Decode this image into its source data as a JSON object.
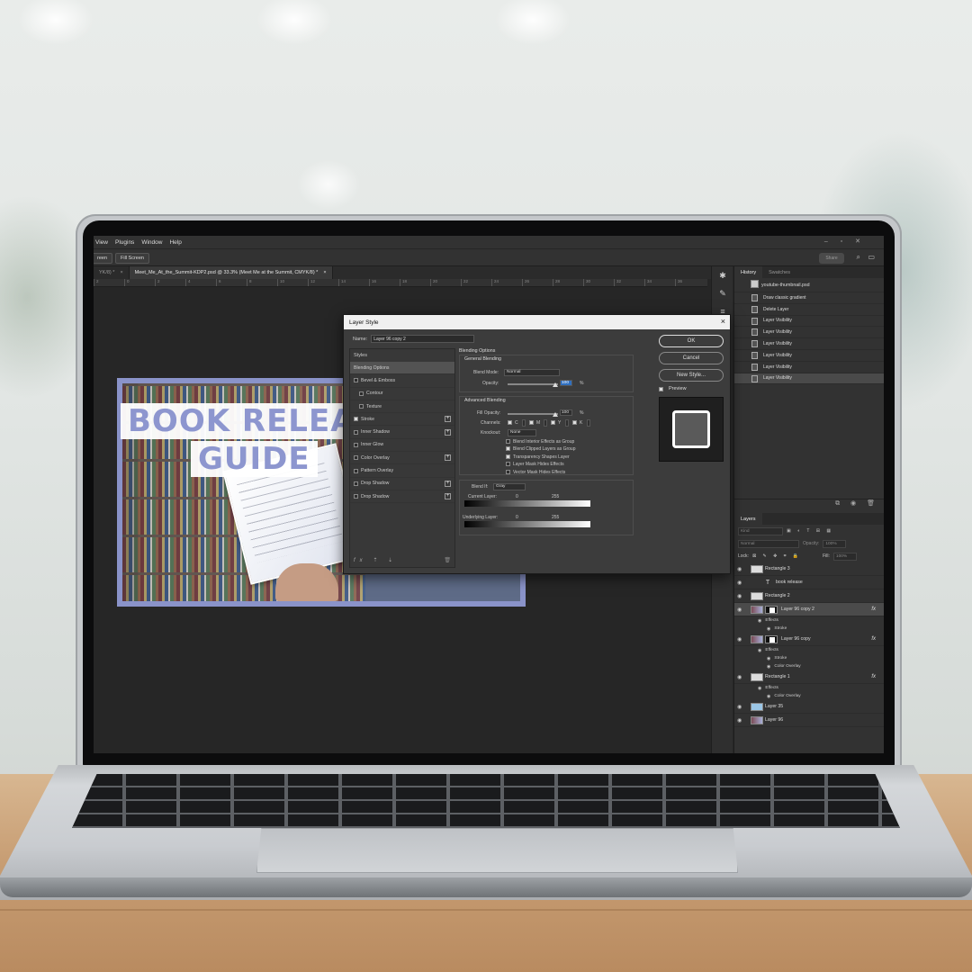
{
  "menu": [
    "View",
    "Plugins",
    "Window",
    "Help"
  ],
  "options": {
    "screen_btn": "reen",
    "fill_screen_btn": "Fill Screen",
    "share_btn": "Share"
  },
  "tabs": [
    {
      "label": "YK/8) *",
      "close": "×"
    },
    {
      "label": "Meet_Me_At_the_Summit-KDP2.psd @ 33.3% (Meet Me at the Summit, CMYK/8) *",
      "close": "×"
    }
  ],
  "ruler_ticks": [
    "2",
    "0",
    "2",
    "4",
    "6",
    "8",
    "10",
    "12",
    "14",
    "16",
    "18",
    "20",
    "22",
    "24",
    "26",
    "28",
    "30",
    "32",
    "34",
    "36"
  ],
  "canvas": {
    "title_line1": "BOOK RELEASE",
    "title_line2": "GUIDE"
  },
  "dialog": {
    "title": "Layer Style",
    "close": "×",
    "name_label": "Name:",
    "name_value": "Layer 96 copy 2",
    "styles_header": "Styles",
    "styles": [
      {
        "label": "Blending Options",
        "checkbox": false,
        "checked": false,
        "plus": false,
        "active": true,
        "indent": false
      },
      {
        "label": "Bevel & Emboss",
        "checkbox": true,
        "checked": false,
        "plus": false,
        "active": false,
        "indent": false
      },
      {
        "label": "Contour",
        "checkbox": true,
        "checked": false,
        "plus": false,
        "active": false,
        "indent": true
      },
      {
        "label": "Texture",
        "checkbox": true,
        "checked": false,
        "plus": false,
        "active": false,
        "indent": true
      },
      {
        "label": "Stroke",
        "checkbox": true,
        "checked": true,
        "plus": true,
        "active": false,
        "indent": false
      },
      {
        "label": "Inner Shadow",
        "checkbox": true,
        "checked": false,
        "plus": true,
        "active": false,
        "indent": false
      },
      {
        "label": "Inner Glow",
        "checkbox": true,
        "checked": false,
        "plus": false,
        "active": false,
        "indent": false
      },
      {
        "label": "Color Overlay",
        "checkbox": true,
        "checked": false,
        "plus": true,
        "active": false,
        "indent": false
      },
      {
        "label": "Pattern Overlay",
        "checkbox": true,
        "checked": false,
        "plus": false,
        "active": false,
        "indent": false
      },
      {
        "label": "Drop Shadow",
        "checkbox": true,
        "checked": false,
        "plus": true,
        "active": false,
        "indent": false
      },
      {
        "label": "Drop Shadow",
        "checkbox": true,
        "checked": false,
        "plus": true,
        "active": false,
        "indent": false
      }
    ],
    "fx_label": "fx",
    "blending": {
      "section": "Blending Options",
      "general": "General Blending",
      "blend_mode_label": "Blend Mode:",
      "blend_mode": "Normal",
      "opacity_label": "Opacity:",
      "opacity": "100",
      "pct": "%",
      "advanced": "Advanced Blending",
      "fill_opacity_label": "Fill Opacity:",
      "fill_opacity": "100",
      "channels_label": "Channels:",
      "channels": [
        "C",
        "M",
        "Y",
        "K"
      ],
      "knockout_label": "Knockout:",
      "knockout": "None",
      "options": [
        {
          "label": "Blend Interior Effects as Group",
          "checked": false
        },
        {
          "label": "Blend Clipped Layers as Group",
          "checked": true
        },
        {
          "label": "Transparency Shapes Layer",
          "checked": true
        },
        {
          "label": "Layer Mask Hides Effects",
          "checked": false
        },
        {
          "label": "Vector Mask Hides Effects",
          "checked": false
        }
      ],
      "blend_if_label": "Blend If:",
      "blend_if": "Gray",
      "current_layer_label": "Current Layer:",
      "underlying_layer_label": "Underlying Layer:",
      "range_min": "0",
      "range_max": "255"
    },
    "buttons": {
      "ok": "OK",
      "cancel": "Cancel",
      "new_style": "New Style..."
    },
    "preview_label": "Preview"
  },
  "history": {
    "tabs": [
      "History",
      "Swatches"
    ],
    "snapshot": "youtube-thumbnail.psd",
    "items": [
      {
        "label": "Draw classic gradient",
        "active": false
      },
      {
        "label": "Delete Layer",
        "active": false
      },
      {
        "label": "Layer Visibility",
        "active": false
      },
      {
        "label": "Layer Visibility",
        "active": false
      },
      {
        "label": "Layer Visibility",
        "active": false
      },
      {
        "label": "Layer Visibility",
        "active": false
      },
      {
        "label": "Layer Visibility",
        "active": false
      },
      {
        "label": "Layer Visibility",
        "active": true
      }
    ]
  },
  "layers": {
    "tab": "Layers",
    "kind_placeholder": "Kind",
    "blend_mode": "Normal",
    "opacity_label": "Opacity:",
    "opacity_value": "100%",
    "lock_label": "Lock:",
    "fill_label": "Fill:",
    "fill_value": "100%",
    "items": [
      {
        "kind": "layer",
        "label": "Rectangle 3",
        "thumb": "shape",
        "fx": false,
        "active": false
      },
      {
        "kind": "text",
        "label": "book release",
        "fx": false,
        "active": false
      },
      {
        "kind": "layer",
        "label": "Rectangle 2",
        "thumb": "shape",
        "fx": false,
        "active": false
      },
      {
        "kind": "layer",
        "label": "Layer 96 copy 2",
        "thumb": "photo",
        "mask": true,
        "fx": true,
        "active": true
      },
      {
        "kind": "sub",
        "label": "Effects",
        "level": 1
      },
      {
        "kind": "sub",
        "label": "Stroke",
        "level": 2
      },
      {
        "kind": "layer",
        "label": "Layer 96 copy",
        "thumb": "photo",
        "mask": true,
        "fx": true,
        "active": false
      },
      {
        "kind": "sub",
        "label": "Effects",
        "level": 1
      },
      {
        "kind": "sub",
        "label": "Stroke",
        "level": 2
      },
      {
        "kind": "sub",
        "label": "Color Overlay",
        "level": 2
      },
      {
        "kind": "layer",
        "label": "Rectangle 1",
        "thumb": "shape",
        "fx": true,
        "active": false
      },
      {
        "kind": "sub",
        "label": "Effects",
        "level": 1
      },
      {
        "kind": "sub",
        "label": "Color Overlay",
        "level": 2
      },
      {
        "kind": "layer",
        "label": "Layer 35",
        "thumb": "blue",
        "fx": false,
        "active": false
      },
      {
        "kind": "layer",
        "label": "Layer 96",
        "thumb": "photo",
        "fx": false,
        "active": false
      }
    ]
  }
}
